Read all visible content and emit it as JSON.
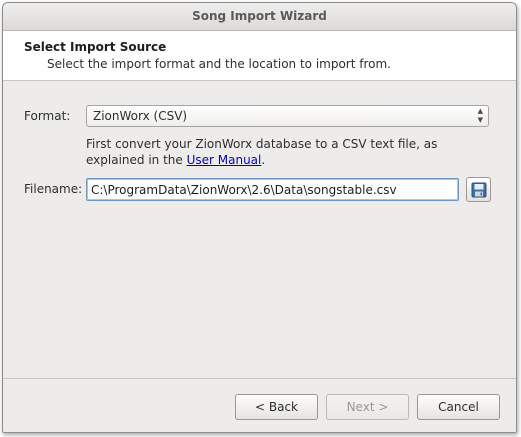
{
  "window": {
    "title": "Song Import Wizard"
  },
  "header": {
    "title": "Select Import Source",
    "subtitle": "Select the import format and the location to import from."
  },
  "format": {
    "label": "Format:",
    "selected": "ZionWorx (CSV)"
  },
  "hint": {
    "text": "First convert your ZionWorx database to a CSV text file, as explained in the ",
    "link": "User Manual",
    "suffix": "."
  },
  "filename": {
    "label": "Filename:",
    "value": "C:\\ProgramData\\ZionWorx\\2.6\\Data\\songstable.csv"
  },
  "buttons": {
    "back": "< Back",
    "next": "Next >",
    "cancel": "Cancel"
  },
  "colors": {
    "link": "#0000cc",
    "focus_border": "#6d98c8",
    "window_bg": "#edeceb"
  }
}
